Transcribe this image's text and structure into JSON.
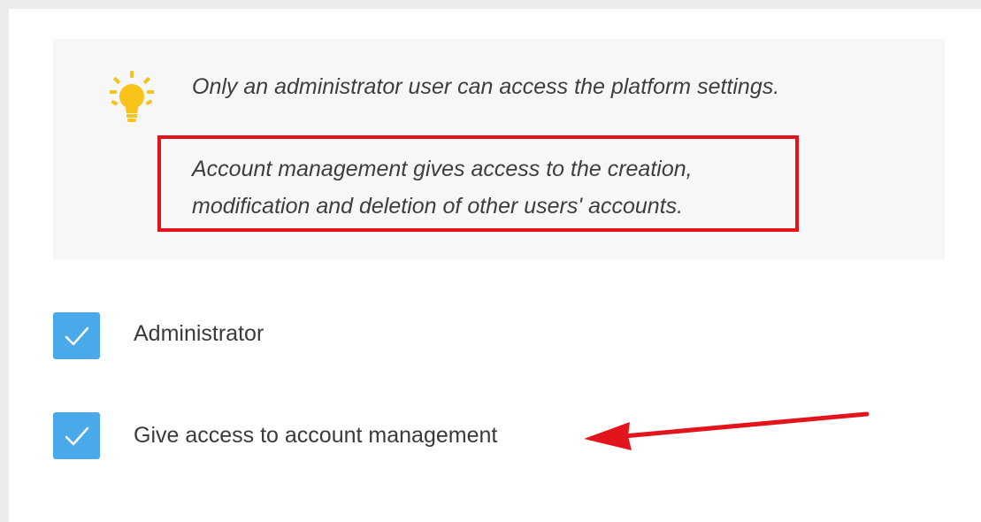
{
  "info": {
    "line1": "Only an administrator user can access the platform settings.",
    "line2a": "Account management gives access to the creation,",
    "line2b": "modification and deletion of other users' accounts."
  },
  "icons": {
    "bulb": "lightbulb-icon",
    "check": "checkmark-icon",
    "arrow": "annotation-arrow"
  },
  "checkboxes": [
    {
      "label": "Administrator",
      "checked": true
    },
    {
      "label": "Give access to account management",
      "checked": true
    }
  ],
  "colors": {
    "checkbox": "#4aa9e9",
    "highlight": "#e3141c",
    "bulb": "#f7c21a",
    "infoBackground": "#f7f7f7"
  }
}
